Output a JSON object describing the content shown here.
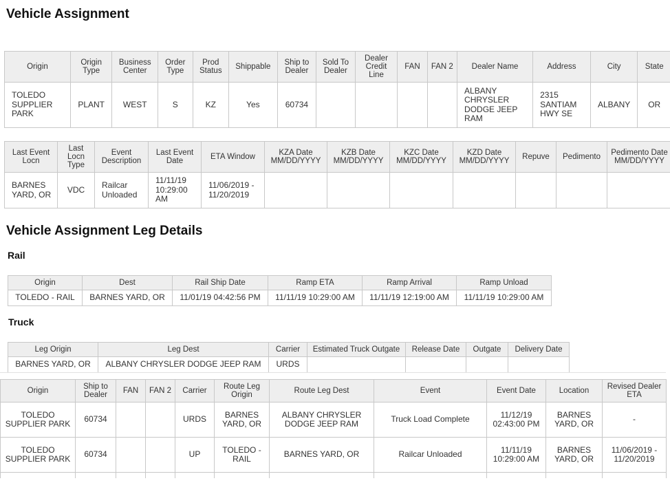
{
  "title": "Vehicle Assignment",
  "assignment": {
    "headers": [
      "Origin",
      "Origin Type",
      "Business Center",
      "Order Type",
      "Prod Status",
      "Shippable",
      "Ship to Dealer",
      "Sold To Dealer",
      "Dealer Credit Line",
      "FAN",
      "FAN 2",
      "Dealer Name",
      "Address",
      "City",
      "State"
    ],
    "row": [
      "TOLEDO SUPPLIER PARK",
      "PLANT",
      "WEST",
      "S",
      "KZ",
      "Yes",
      "60734",
      "",
      "",
      "",
      "",
      "ALBANY CHRYSLER DODGE JEEP RAM",
      "2315 SANTIAM HWY SE",
      "ALBANY",
      "OR"
    ]
  },
  "event": {
    "headers": [
      "Last Event Locn",
      "Last Locn Type",
      "Event Description",
      "Last Event Date",
      "ETA Window",
      "KZA Date MM/DD/YYYY",
      "KZB Date MM/DD/YYYY",
      "KZC Date MM/DD/YYYY",
      "KZD Date MM/DD/YYYY",
      "Repuve",
      "Pedimento",
      "Pedimento Date MM/DD/YYYY"
    ],
    "row": [
      "BARNES YARD, OR",
      "VDC",
      "Railcar Unloaded",
      "11/11/19 10:29:00 AM",
      "11/06/2019 - 11/20/2019",
      "",
      "",
      "",
      "",
      "",
      "",
      ""
    ]
  },
  "leg_title": "Vehicle Assignment Leg Details",
  "rail": {
    "title": "Rail",
    "headers": [
      "Origin",
      "Dest",
      "Rail Ship Date",
      "Ramp ETA",
      "Ramp Arrival",
      "Ramp Unload"
    ],
    "row": [
      "TOLEDO - RAIL",
      "BARNES YARD, OR",
      "11/01/19 04:42:56 PM",
      "11/11/19 10:29:00 AM",
      "11/11/19 12:19:00 AM",
      "11/11/19 10:29:00 AM"
    ]
  },
  "truck": {
    "title": "Truck",
    "headers": [
      "Leg Origin",
      "Leg Dest",
      "Carrier",
      "Estimated Truck Outgate",
      "Release Date",
      "Outgate",
      "Delivery Date"
    ],
    "row": [
      "BARNES YARD, OR",
      "ALBANY CHRYSLER DODGE JEEP RAM",
      "URDS",
      "",
      "",
      "",
      ""
    ]
  },
  "history": {
    "headers": [
      "Origin",
      "Ship to Dealer",
      "FAN",
      "FAN 2",
      "Carrier",
      "Route Leg Origin",
      "Route Leg Dest",
      "Event",
      "Event Date",
      "Location",
      "Revised Dealer ETA"
    ],
    "rows": [
      [
        "TOLEDO SUPPLIER PARK",
        "60734",
        "",
        "",
        "URDS",
        "BARNES YARD, OR",
        "ALBANY CHRYSLER DODGE JEEP RAM",
        "Truck Load Complete",
        "11/12/19 02:43:00 PM",
        "BARNES YARD, OR",
        "-"
      ],
      [
        "TOLEDO SUPPLIER PARK",
        "60734",
        "",
        "",
        "UP",
        "TOLEDO - RAIL",
        "BARNES YARD, OR",
        "Railcar Unloaded",
        "11/11/19 10:29:00 AM",
        "BARNES YARD, OR",
        "11/06/2019 - 11/20/2019"
      ]
    ]
  }
}
